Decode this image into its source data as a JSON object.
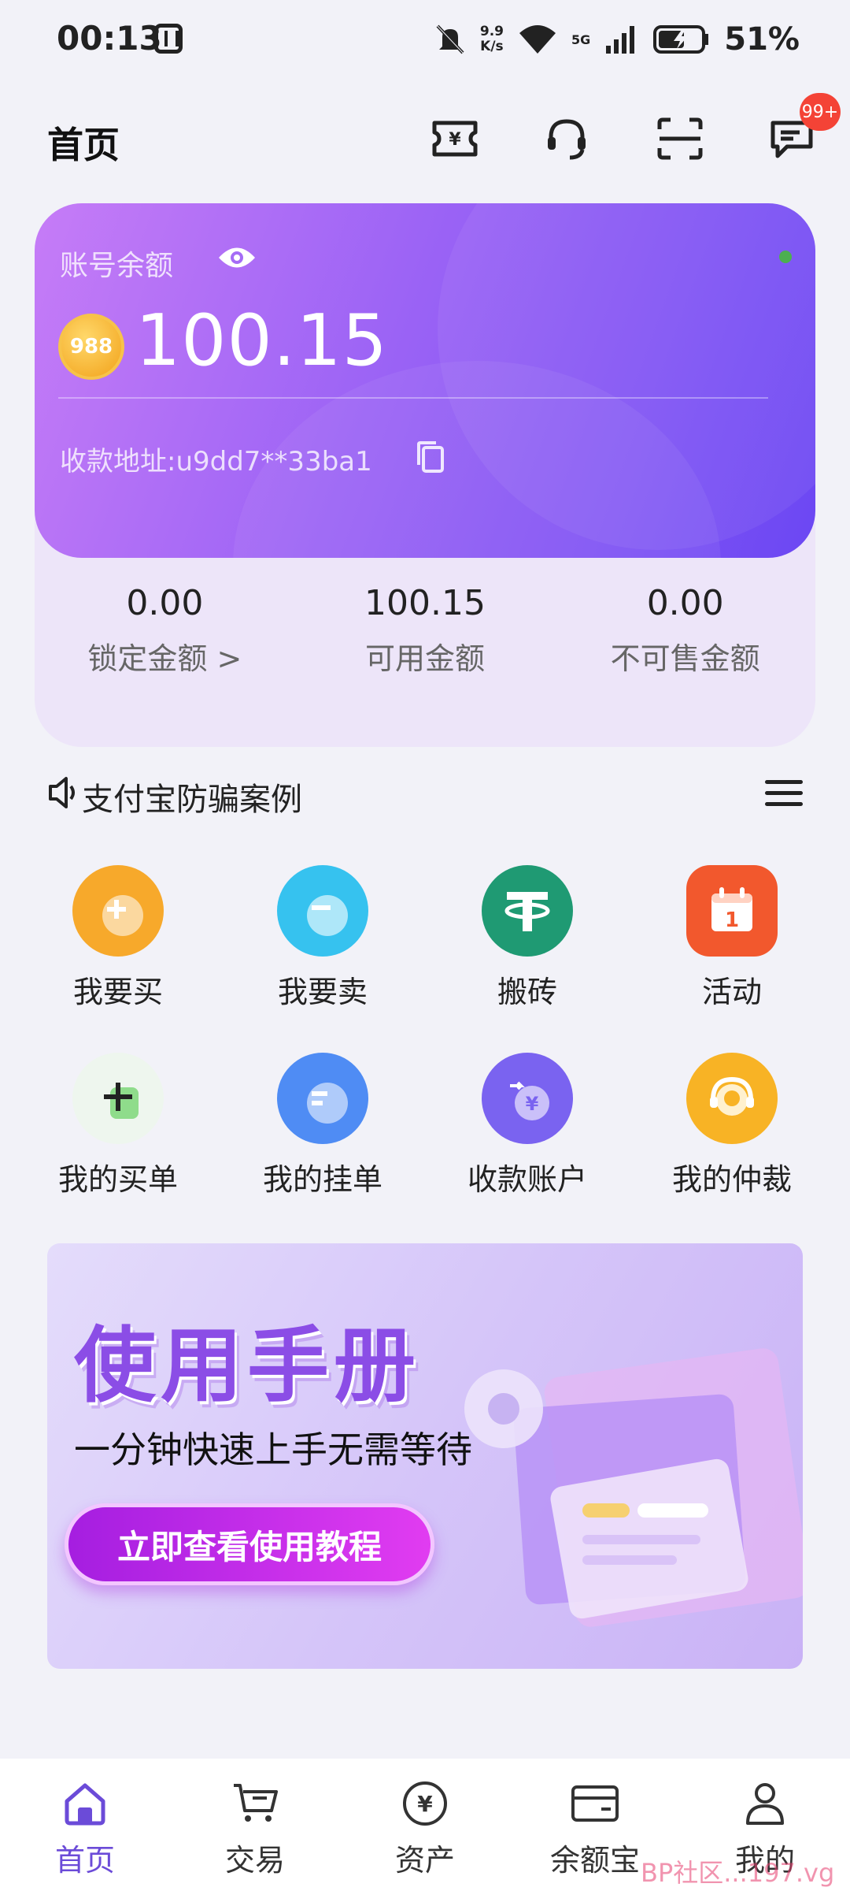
{
  "status_bar": {
    "time": "00:13",
    "speed": "9.9\nK/s",
    "network": "5G",
    "battery": "51%"
  },
  "header": {
    "title": "首页",
    "icons": [
      "voucher-icon",
      "headset-icon",
      "scan-icon",
      "message-icon"
    ],
    "message_badge": "99+"
  },
  "balance_card": {
    "label": "账号余额",
    "coin_label": "988",
    "amount": "100.15",
    "address": "收款地址:u9dd7**33ba1"
  },
  "stats": [
    {
      "value": "0.00",
      "label": "锁定金额 >"
    },
    {
      "value": "100.15",
      "label": "可用金额"
    },
    {
      "value": "0.00",
      "label": "不可售金额"
    }
  ],
  "notice": {
    "text": "支付宝防骗案例"
  },
  "grid": [
    {
      "label": "我要买",
      "icon": "buy-icon",
      "color": "#f7a92b"
    },
    {
      "label": "我要卖",
      "icon": "sell-icon",
      "color": "#36c2ef"
    },
    {
      "label": "搬砖",
      "icon": "tether-icon",
      "color": "#1f9a73"
    },
    {
      "label": "活动",
      "icon": "calendar-icon",
      "color": "#f2582d"
    },
    {
      "label": "我的买单",
      "icon": "my-buy-order-icon",
      "color": "#eef6ee"
    },
    {
      "label": "我的挂单",
      "icon": "my-sell-order-icon",
      "color": "#4f8cf4"
    },
    {
      "label": "收款账户",
      "icon": "receive-account-icon",
      "color": "#7a63f0"
    },
    {
      "label": "我的仲裁",
      "icon": "arbitration-icon",
      "color": "#f8b325"
    }
  ],
  "banner": {
    "title": "使用手册",
    "subtitle": "一分钟快速上手无需等待",
    "button": "立即查看使用教程"
  },
  "bottom_nav": [
    {
      "label": "首页",
      "icon": "home-icon",
      "active": true
    },
    {
      "label": "交易",
      "icon": "cart-icon",
      "active": false
    },
    {
      "label": "资产",
      "icon": "yuan-icon",
      "active": false
    },
    {
      "label": "余额宝",
      "icon": "wallet-icon",
      "active": false
    },
    {
      "label": "我的",
      "icon": "profile-icon",
      "active": false
    }
  ],
  "watermark": "BP社区...197.vg",
  "colors": {
    "accent": "#6b4bd8",
    "card_start": "#c67cf7",
    "card_end": "#6b47f3"
  }
}
